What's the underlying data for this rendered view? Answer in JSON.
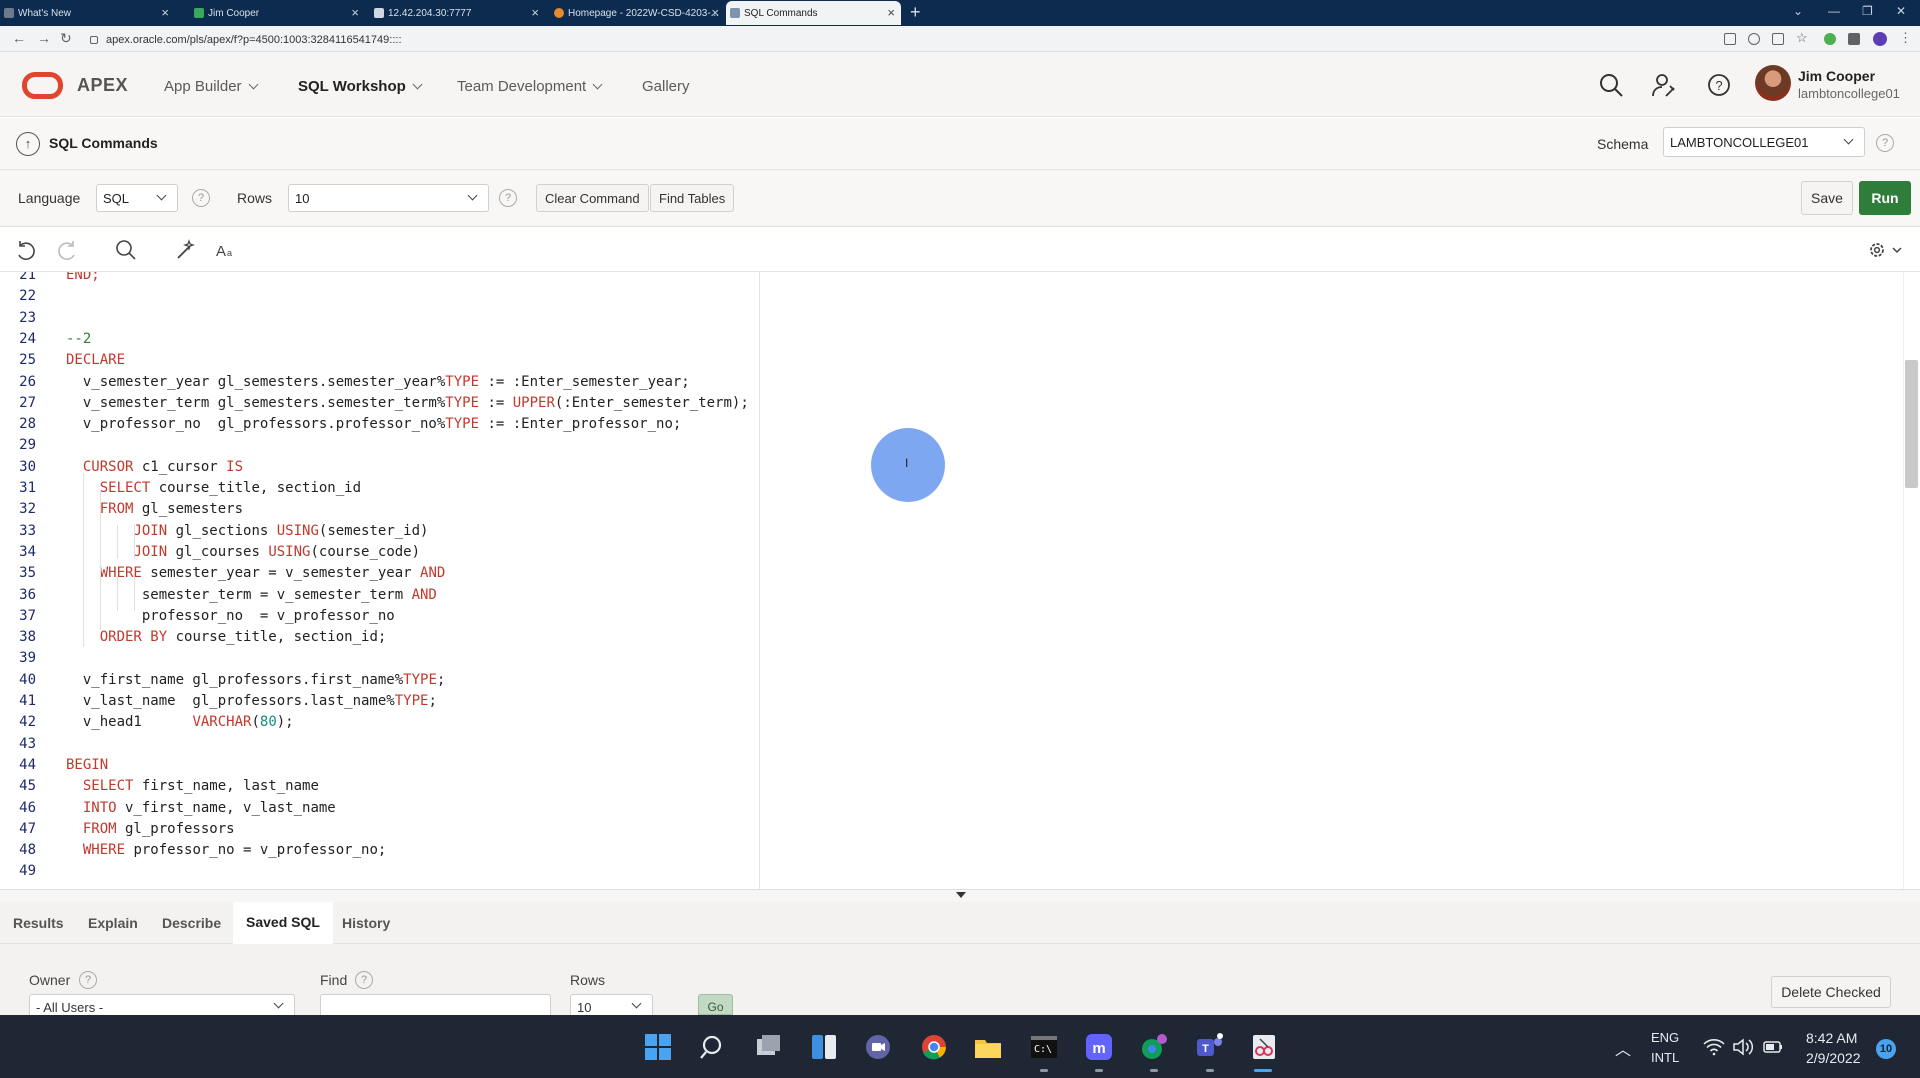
{
  "browser": {
    "tabs": [
      {
        "title": "What's New"
      },
      {
        "title": "Jim Cooper"
      },
      {
        "title": "12.42.204.30:7777"
      },
      {
        "title": "Homepage - 2022W-CSD-4203-..."
      },
      {
        "title": "SQL Commands"
      }
    ],
    "url": "apex.oracle.com/pls/apex/f?p=4500:1003:3284116541749::::"
  },
  "header": {
    "brand": "APEX",
    "menus": [
      {
        "label": "App Builder"
      },
      {
        "label": "SQL Workshop"
      },
      {
        "label": "Team Development"
      },
      {
        "label": "Gallery"
      }
    ],
    "user": {
      "name": "Jim Cooper",
      "schema": "lambtoncollege01"
    }
  },
  "page": {
    "title": "SQL Commands",
    "schema_label": "Schema",
    "schema_value": "LAMBTONCOLLEGE01"
  },
  "toolbar": {
    "language_label": "Language",
    "language_value": "SQL",
    "rows_label": "Rows",
    "rows_value": "10",
    "clear_command": "Clear Command",
    "find_tables": "Find Tables",
    "save": "Save",
    "run": "Run"
  },
  "editor": {
    "lines": [
      {
        "n": "21",
        "segments": [
          {
            "t": "END;",
            "c": "kw"
          }
        ]
      },
      {
        "n": "22",
        "segments": []
      },
      {
        "n": "23",
        "segments": []
      },
      {
        "n": "24",
        "segments": [
          {
            "t": "--2",
            "c": "cm"
          }
        ]
      },
      {
        "n": "25",
        "segments": [
          {
            "t": "DECLARE",
            "c": "kw"
          }
        ]
      },
      {
        "n": "26",
        "segments": [
          {
            "t": "  v_semester_year gl_semesters.semester_year%",
            "c": ""
          },
          {
            "t": "TYPE",
            "c": "kw"
          },
          {
            "t": " := :Enter_semester_year;",
            "c": ""
          }
        ]
      },
      {
        "n": "27",
        "segments": [
          {
            "t": "  v_semester_term gl_semesters.semester_term%",
            "c": ""
          },
          {
            "t": "TYPE",
            "c": "kw"
          },
          {
            "t": " := ",
            "c": ""
          },
          {
            "t": "UPPER",
            "c": "kw"
          },
          {
            "t": "(:Enter_semester_term);",
            "c": ""
          }
        ]
      },
      {
        "n": "28",
        "segments": [
          {
            "t": "  v_professor_no  gl_professors.professor_no%",
            "c": ""
          },
          {
            "t": "TYPE",
            "c": "kw"
          },
          {
            "t": " := :Enter_professor_no;",
            "c": ""
          }
        ]
      },
      {
        "n": "29",
        "segments": []
      },
      {
        "n": "30",
        "segments": [
          {
            "t": "  ",
            "c": ""
          },
          {
            "t": "CURSOR",
            "c": "kw"
          },
          {
            "t": " c1_cursor ",
            "c": ""
          },
          {
            "t": "IS",
            "c": "kw"
          }
        ]
      },
      {
        "n": "31",
        "segments": [
          {
            "t": "    ",
            "c": ""
          },
          {
            "t": "SELECT",
            "c": "kw"
          },
          {
            "t": " course_title, section_id",
            "c": ""
          }
        ]
      },
      {
        "n": "32",
        "segments": [
          {
            "t": "    ",
            "c": ""
          },
          {
            "t": "FROM",
            "c": "kw"
          },
          {
            "t": " gl_semesters",
            "c": ""
          }
        ]
      },
      {
        "n": "33",
        "segments": [
          {
            "t": "        ",
            "c": ""
          },
          {
            "t": "JOIN",
            "c": "kw"
          },
          {
            "t": " gl_sections ",
            "c": ""
          },
          {
            "t": "USING",
            "c": "kw"
          },
          {
            "t": "(semester_id)",
            "c": ""
          }
        ]
      },
      {
        "n": "34",
        "segments": [
          {
            "t": "        ",
            "c": ""
          },
          {
            "t": "JOIN",
            "c": "kw"
          },
          {
            "t": " gl_courses ",
            "c": ""
          },
          {
            "t": "USING",
            "c": "kw"
          },
          {
            "t": "(course_code)",
            "c": ""
          }
        ]
      },
      {
        "n": "35",
        "segments": [
          {
            "t": "    ",
            "c": ""
          },
          {
            "t": "WHERE",
            "c": "kw"
          },
          {
            "t": " semester_year = v_semester_year ",
            "c": ""
          },
          {
            "t": "AND",
            "c": "kw"
          }
        ]
      },
      {
        "n": "36",
        "segments": [
          {
            "t": "         semester_term = v_semester_term ",
            "c": ""
          },
          {
            "t": "AND",
            "c": "kw"
          }
        ]
      },
      {
        "n": "37",
        "segments": [
          {
            "t": "         professor_no  = v_professor_no",
            "c": ""
          }
        ]
      },
      {
        "n": "38",
        "segments": [
          {
            "t": "    ",
            "c": ""
          },
          {
            "t": "ORDER BY",
            "c": "kw"
          },
          {
            "t": " course_title, section_id;",
            "c": ""
          }
        ]
      },
      {
        "n": "39",
        "segments": []
      },
      {
        "n": "40",
        "segments": [
          {
            "t": "  v_first_name gl_professors.first_name%",
            "c": ""
          },
          {
            "t": "TYPE",
            "c": "kw"
          },
          {
            "t": ";",
            "c": ""
          }
        ]
      },
      {
        "n": "41",
        "segments": [
          {
            "t": "  v_last_name  gl_professors.last_name%",
            "c": ""
          },
          {
            "t": "TYPE",
            "c": "kw"
          },
          {
            "t": ";",
            "c": ""
          }
        ]
      },
      {
        "n": "42",
        "segments": [
          {
            "t": "  v_head1      ",
            "c": ""
          },
          {
            "t": "VARCHAR",
            "c": "kw"
          },
          {
            "t": "(",
            "c": ""
          },
          {
            "t": "80",
            "c": "num"
          },
          {
            "t": ");",
            "c": ""
          }
        ]
      },
      {
        "n": "43",
        "segments": []
      },
      {
        "n": "44",
        "segments": [
          {
            "t": "BEGIN",
            "c": "kw"
          }
        ]
      },
      {
        "n": "45",
        "segments": [
          {
            "t": "  ",
            "c": ""
          },
          {
            "t": "SELECT",
            "c": "kw"
          },
          {
            "t": " first_name, last_name",
            "c": ""
          }
        ]
      },
      {
        "n": "46",
        "segments": [
          {
            "t": "  ",
            "c": ""
          },
          {
            "t": "INTO",
            "c": "kw"
          },
          {
            "t": " v_first_name, v_last_name",
            "c": ""
          }
        ]
      },
      {
        "n": "47",
        "segments": [
          {
            "t": "  ",
            "c": ""
          },
          {
            "t": "FROM",
            "c": "kw"
          },
          {
            "t": " gl_professors",
            "c": ""
          }
        ]
      },
      {
        "n": "48",
        "segments": [
          {
            "t": "  ",
            "c": ""
          },
          {
            "t": "WHERE",
            "c": "kw"
          },
          {
            "t": " professor_no = v_professor_no;",
            "c": ""
          }
        ]
      },
      {
        "n": "49",
        "segments": []
      }
    ]
  },
  "results": {
    "tabs": [
      {
        "label": "Results"
      },
      {
        "label": "Explain"
      },
      {
        "label": "Describe"
      },
      {
        "label": "Saved SQL"
      },
      {
        "label": "History"
      }
    ],
    "active_tab": "Saved SQL",
    "owner_label": "Owner",
    "owner_value": "- All Users -",
    "find_label": "Find",
    "find_value": "",
    "rows_label": "Rows",
    "rows_value": "10",
    "go": "Go",
    "delete_checked": "Delete Checked"
  },
  "taskbar": {
    "lang_top": "ENG",
    "lang_bottom": "INTL",
    "time": "8:42 AM",
    "date": "2/9/2022",
    "notifications": "10"
  },
  "colors": {
    "brand": "#e0462e",
    "run_button": "#2f7d3b",
    "keyword": "#c0392b",
    "comment": "#2e7d32",
    "cursor_highlight": "#7ea7f2"
  }
}
